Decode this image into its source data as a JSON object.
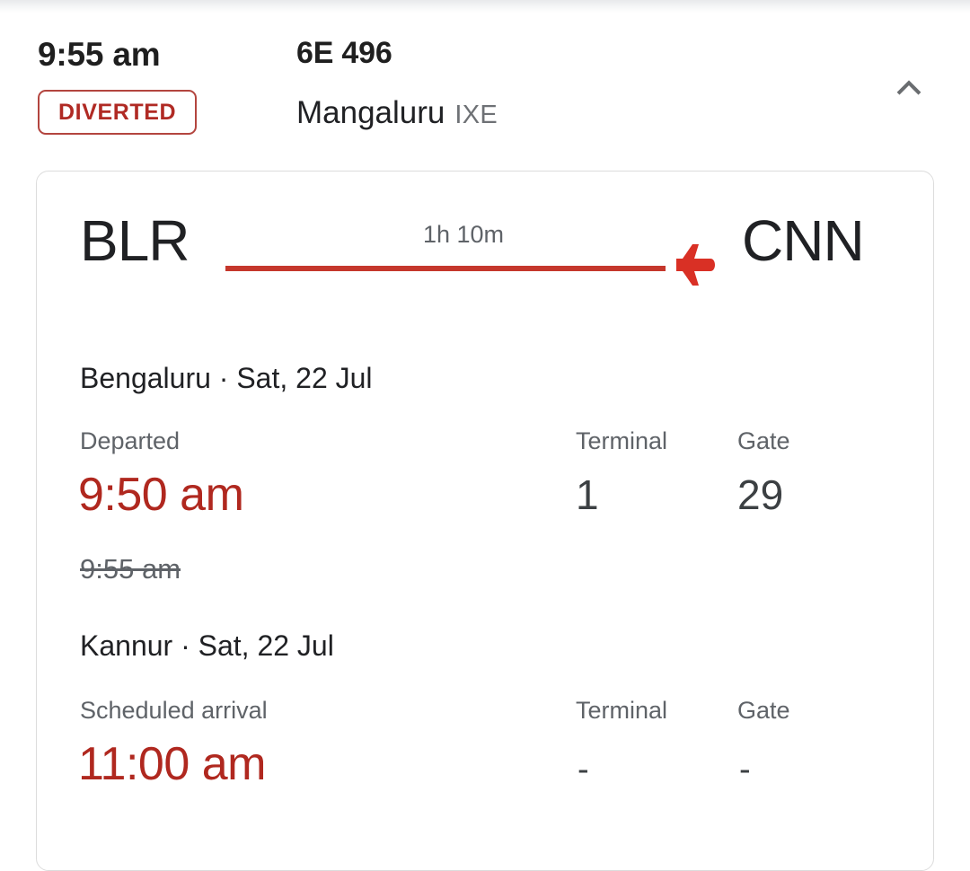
{
  "header": {
    "scheduled_time": "9:55 am",
    "status": "DIVERTED",
    "flight_number": "6E 496",
    "destination_city": "Mangaluru",
    "destination_code": "IXE",
    "collapse_icon": "chevron-up-icon"
  },
  "route": {
    "origin_code": "BLR",
    "destination_code": "CNN",
    "duration": "1h 10m",
    "plane_icon": "airplane-icon"
  },
  "departure": {
    "city_date": "Bengaluru · Sat, 22 Jul",
    "status_label": "Departed",
    "time": "9:50 am",
    "previous_time": "9:55 am",
    "terminal_label": "Terminal",
    "terminal_value": "1",
    "gate_label": "Gate",
    "gate_value": "29"
  },
  "arrival": {
    "city_date": "Kannur · Sat, 22 Jul",
    "status_label": "Scheduled arrival",
    "time": "11:00 am",
    "terminal_label": "Terminal",
    "terminal_value": "-",
    "gate_label": "Gate",
    "gate_value": "-"
  },
  "colors": {
    "accent_red": "#b0281f",
    "route_red": "#c5372c",
    "badge_border": "#b3453f",
    "text_primary": "#202124",
    "text_secondary": "#5f6368",
    "card_border": "#dcdcdc"
  }
}
